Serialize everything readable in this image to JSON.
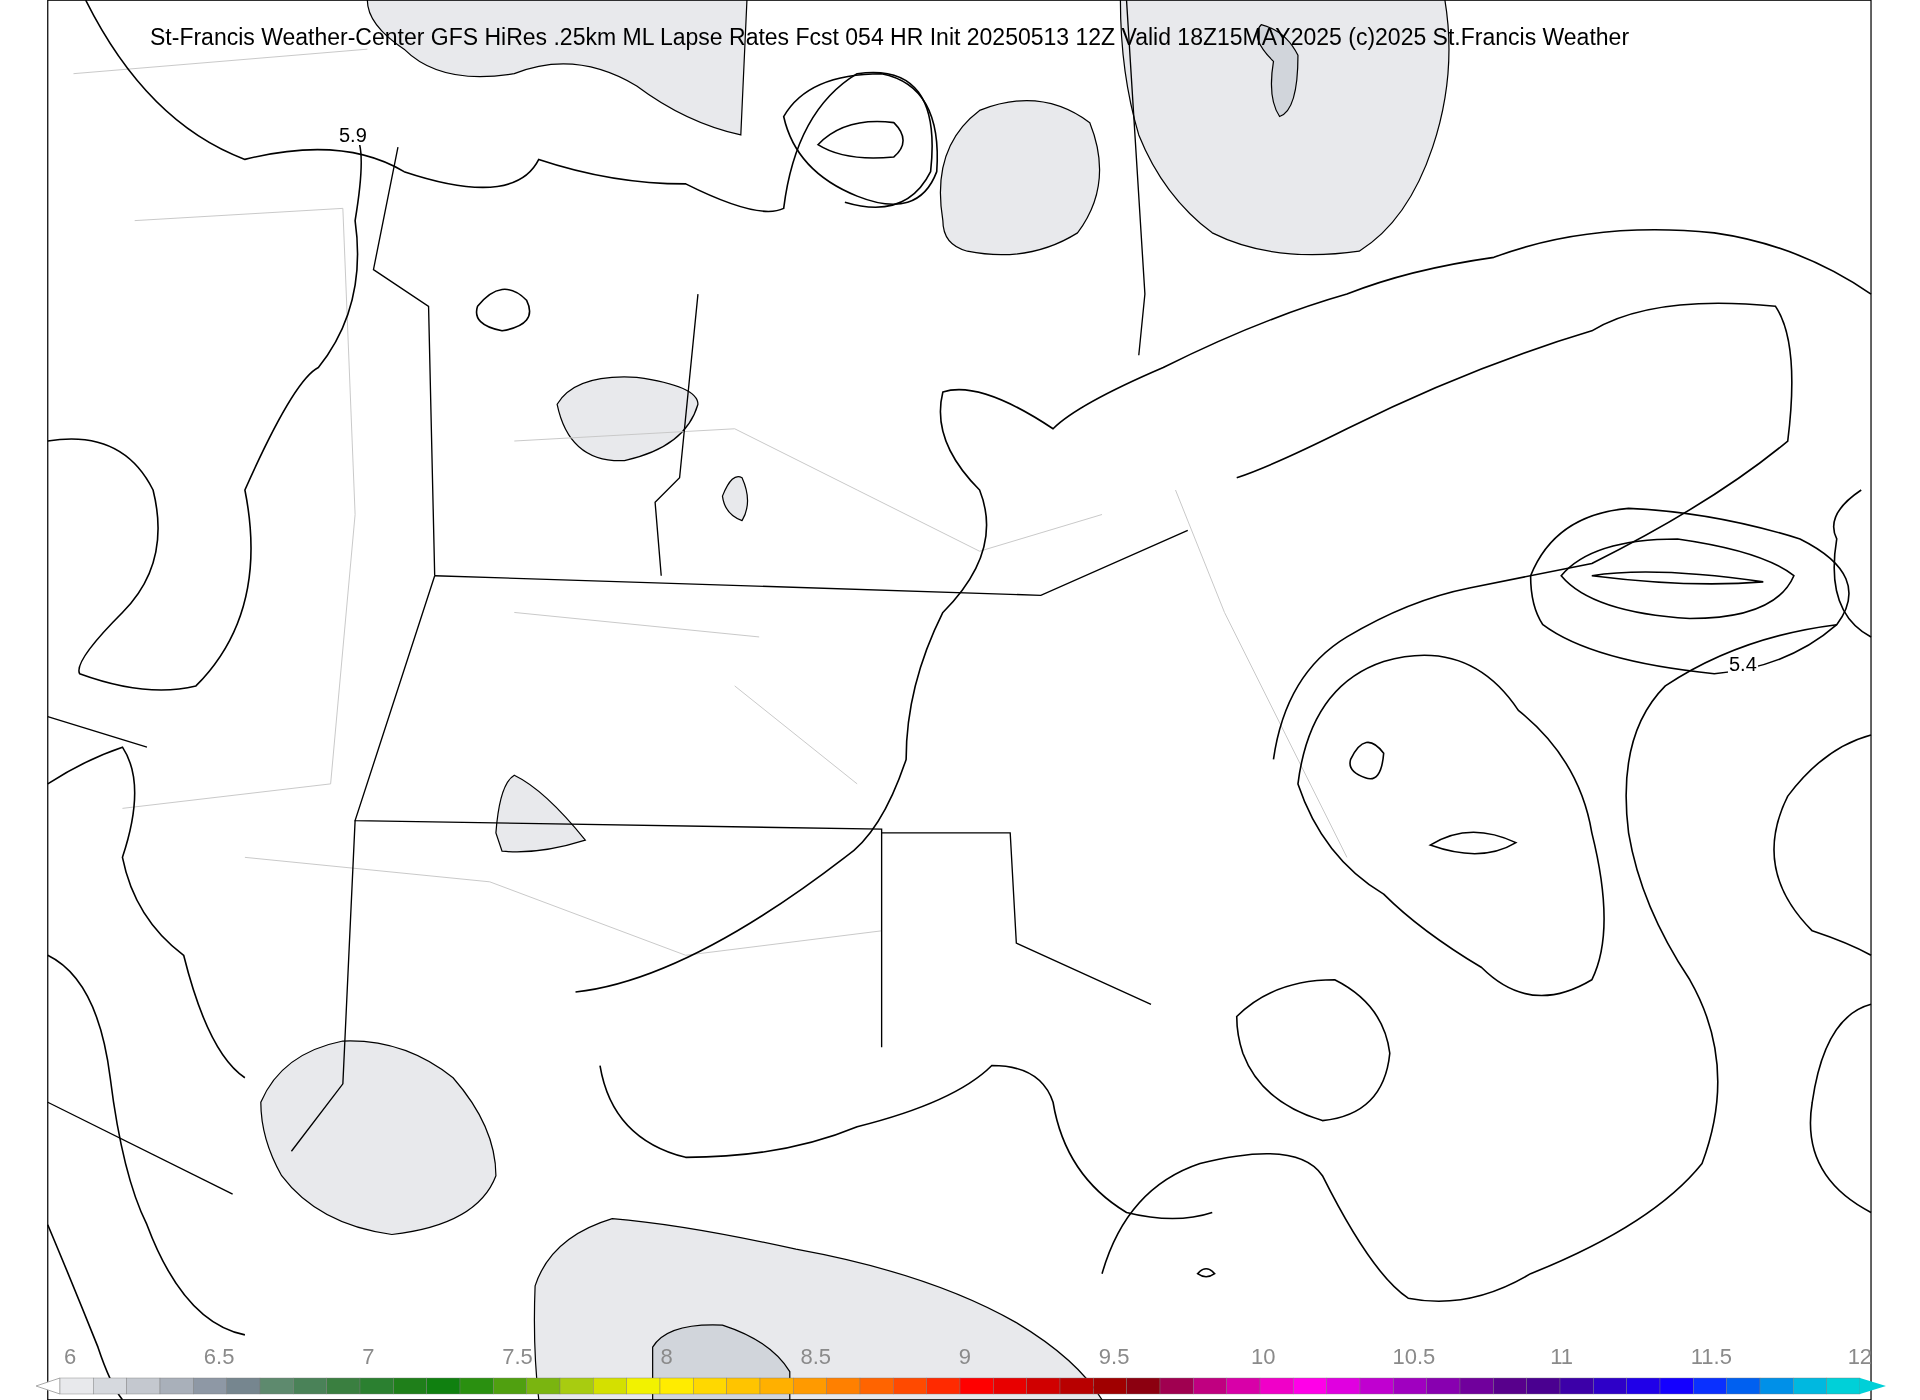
{
  "title": "St-Francis Weather-Center GFS HiRes .25km ML Lapse Rates  Fcst 054 HR Init 20250513 12Z  Valid 18Z15MAY2025    (c)2025 St.Francis Weather",
  "contour_labels": [
    "5.9",
    "5.4"
  ],
  "colorbar": {
    "ticks": [
      "6",
      "6.5",
      "7",
      "7.5",
      "8",
      "8.5",
      "9",
      "9.5",
      "10",
      "10.5",
      "11",
      "11.5",
      "12"
    ]
  }
}
